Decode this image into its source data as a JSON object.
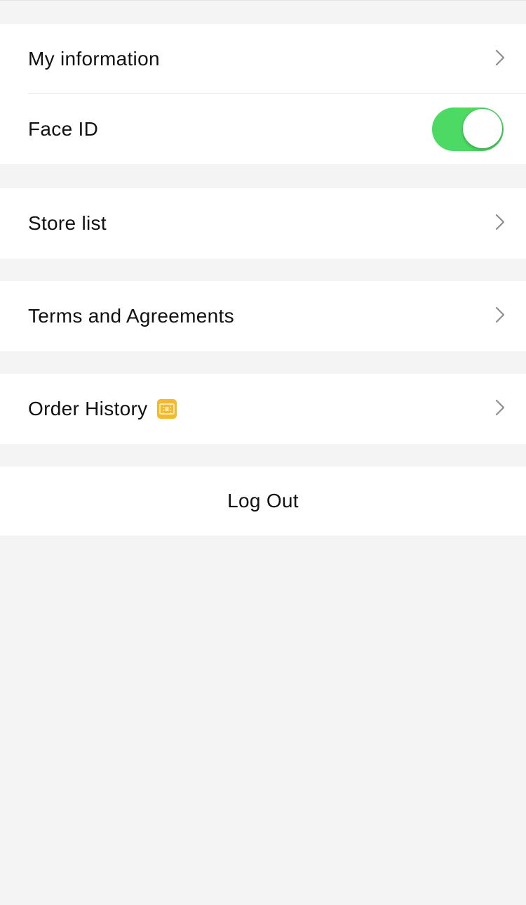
{
  "settings": {
    "my_information": {
      "label": "My information"
    },
    "face_id": {
      "label": "Face ID",
      "enabled": true,
      "toggle_color": "#4cd964"
    },
    "store_list": {
      "label": "Store list"
    },
    "terms": {
      "label": "Terms and Agreements"
    },
    "order_history": {
      "label": "Order History",
      "badge_icon": "ticket-icon",
      "badge_color": "#f5b82e"
    },
    "logout": {
      "label": "Log Out"
    }
  },
  "icons": {
    "chevron": "chevron-right-icon"
  },
  "colors": {
    "background": "#f4f4f4",
    "card": "#ffffff",
    "text": "#111111",
    "chevron": "#8e8e8e"
  }
}
